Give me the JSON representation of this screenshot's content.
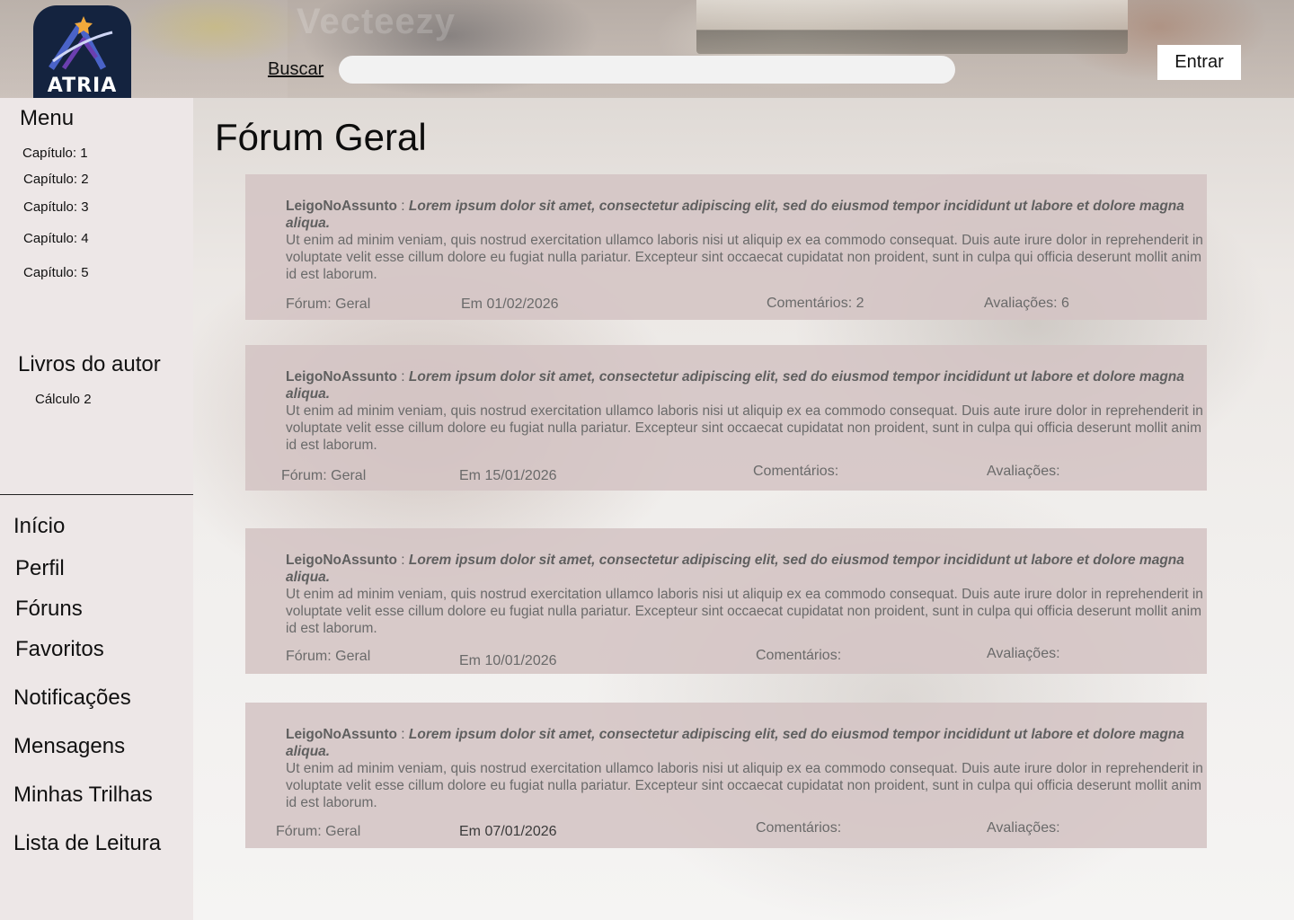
{
  "header": {
    "logo_text": "ATRIA",
    "watermark": "Vecteezy",
    "search_label": "Buscar",
    "search_value": "",
    "search_placeholder": "",
    "login_label": "Entrar"
  },
  "sidebar": {
    "menu_title": "Menu",
    "chapters": [
      "Capítulo: 1",
      "Capítulo: 2",
      "Capítulo: 3",
      "Capítulo: 4",
      "Capítulo: 5"
    ],
    "books_title": "Livros do autor",
    "books": [
      "Cálculo 2"
    ],
    "nav": [
      "Início",
      "Perfil",
      "Fóruns",
      "Favoritos",
      "Notificações",
      "Mensagens",
      "Minhas Trilhas",
      "Lista de Leitura"
    ]
  },
  "main": {
    "title": "Fórum Geral",
    "posts": [
      {
        "author": "LeigoNoAssunto",
        "separator": " : ",
        "lead": "Lorem ipsum dolor sit amet, consectetur adipiscing elit, sed do eiusmod tempor incididunt ut labore et dolore magna aliqua.",
        "text": "Ut enim ad minim veniam, quis nostrud exercitation ullamco laboris nisi ut aliquip ex ea commodo consequat.  Duis aute irure dolor in reprehenderit in voluptate velit esse cillum dolore eu fugiat nulla pariatur.  Excepteur sint occaecat cupidatat non proident, sunt in culpa qui officia deserunt mollit anim id est laborum.",
        "forum": "Fórum: Geral",
        "date": "Em 01/02/2026",
        "comments": "Comentários: 2",
        "ratings": "Avaliações: 6"
      },
      {
        "author": "LeigoNoAssunto",
        "separator": " : ",
        "lead": "Lorem ipsum dolor sit amet, consectetur adipiscing elit, sed do eiusmod tempor incididunt ut labore et dolore magna aliqua.",
        "text": "Ut enim ad minim veniam, quis nostrud exercitation ullamco laboris nisi ut aliquip ex ea commodo consequat.  Duis aute irure dolor in reprehenderit in voluptate velit esse cillum dolore eu fugiat nulla pariatur.  Excepteur sint occaecat cupidatat non proident, sunt in culpa qui officia deserunt mollit anim id est laborum.",
        "forum": "Fórum: Geral",
        "date": "Em 15/01/2026",
        "comments": "Comentários:",
        "ratings": "Avaliações:"
      },
      {
        "author": "LeigoNoAssunto",
        "separator": " : ",
        "lead": "Lorem ipsum dolor sit amet, consectetur adipiscing elit, sed do eiusmod tempor incididunt ut labore et dolore magna aliqua.",
        "text": "Ut enim ad minim veniam, quis nostrud exercitation ullamco laboris nisi ut aliquip ex ea commodo consequat.  Duis aute irure dolor in reprehenderit in voluptate velit esse cillum dolore eu fugiat nulla pariatur.  Excepteur sint occaecat cupidatat non proident, sunt in culpa qui officia deserunt mollit anim id est laborum.",
        "forum": "Fórum: Geral",
        "date": "Em 10/01/2026",
        "comments": "Comentários:",
        "ratings": "Avaliações:"
      },
      {
        "author": "LeigoNoAssunto",
        "separator": " : ",
        "lead": "Lorem ipsum dolor sit amet, consectetur adipiscing elit, sed do eiusmod tempor incididunt ut labore et dolore magna aliqua.",
        "text": "Ut enim ad minim veniam, quis nostrud exercitation ullamco laboris nisi ut aliquip ex ea commodo consequat.  Duis aute irure dolor in reprehenderit in voluptate velit esse cillum dolore eu fugiat nulla pariatur.  Excepteur sint occaecat cupidatat non proident, sunt in culpa qui officia deserunt mollit anim id est laborum.",
        "forum": "Fórum: Geral",
        "date": "Em 07/01/2026",
        "comments": "Comentários:",
        "ratings": "Avaliações:"
      }
    ]
  },
  "colors": {
    "sidebar_bg": "#ede7e7",
    "post_bg": "#d4c4c4",
    "logo_bg": "#14233f",
    "logo_accent": "#f2a93b"
  }
}
